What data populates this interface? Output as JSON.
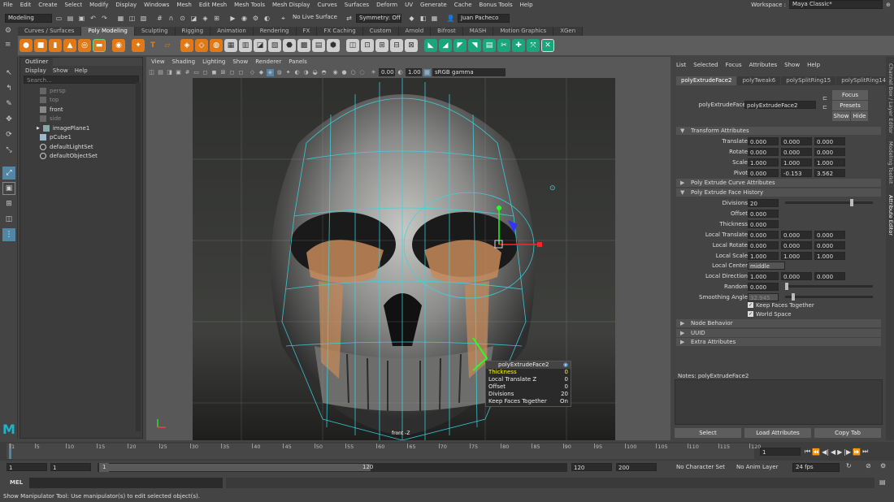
{
  "menubar": {
    "items": [
      "File",
      "Edit",
      "Create",
      "Select",
      "Modify",
      "Display",
      "Windows",
      "Mesh",
      "Edit Mesh",
      "Mesh Tools",
      "Mesh Display",
      "Curves",
      "Surfaces",
      "Deform",
      "UV",
      "Generate",
      "Cache",
      "Bonus Tools",
      "Help"
    ],
    "workspace_label": "Workspace :",
    "workspace_value": "Maya Classic*"
  },
  "statusline": {
    "mode": "Modeling",
    "live_surface": "No Live Surface",
    "symmetry": "Symmetry: Off",
    "user": "Juan Pacheco"
  },
  "shelf": {
    "tabs": [
      "Curves / Surfaces",
      "Poly Modeling",
      "Sculpting",
      "Rigging",
      "Animation",
      "Rendering",
      "FX",
      "FX Caching",
      "Custom",
      "Arnold",
      "Bifrost",
      "MASH",
      "Motion Graphics",
      "XGen"
    ],
    "active_tab": "Poly Modeling"
  },
  "outliner": {
    "title": "Outliner",
    "menu": [
      "Display",
      "Show",
      "Help"
    ],
    "search_placeholder": "Search...",
    "items": [
      {
        "label": "persp",
        "grey": true
      },
      {
        "label": "top",
        "grey": true
      },
      {
        "label": "front",
        "grey": false
      },
      {
        "label": "side",
        "grey": true
      },
      {
        "label": "imagePlane1",
        "grey": false
      },
      {
        "label": "pCube1",
        "grey": false
      },
      {
        "label": "defaultLightSet",
        "grey": false
      },
      {
        "label": "defaultObjectSet",
        "grey": false
      }
    ]
  },
  "viewport": {
    "menu": [
      "View",
      "Shading",
      "Lighting",
      "Show",
      "Renderer",
      "Panels"
    ],
    "exposure": "0.00",
    "gamma": "1.00",
    "colorspace": "sRGB gamma",
    "camera_label": "front -Z"
  },
  "hud": {
    "title": "polyExtrudeFace2",
    "rows": [
      {
        "k": "Thickness",
        "v": "0"
      },
      {
        "k": "Local Translate Z",
        "v": "0"
      },
      {
        "k": "Offset",
        "v": "0"
      },
      {
        "k": "Divisions",
        "v": "20"
      },
      {
        "k": "Keep Faces Together",
        "v": "On"
      }
    ]
  },
  "attr": {
    "menu": [
      "List",
      "Selected",
      "Focus",
      "Attributes",
      "Show",
      "Help"
    ],
    "tabs": [
      "polyExtrudeFace2",
      "polyTweak6",
      "polySplitRing15",
      "polySplitRing14"
    ],
    "node_label": "polyExtrudeFace:",
    "node_value": "polyExtrudeFace2",
    "focus": "Focus",
    "presets": "Presets",
    "show": "Show",
    "hide": "Hide",
    "sections": {
      "transform": "Transform Attributes",
      "curve": "Poly Extrude Curve Attributes",
      "history": "Poly Extrude Face History",
      "node_behavior": "Node Behavior",
      "uuid": "UUID",
      "extra": "Extra Attributes"
    },
    "translate": {
      "label": "Translate",
      "v": [
        "0.000",
        "0.000",
        "0.000"
      ]
    },
    "rotate": {
      "label": "Rotate",
      "v": [
        "0.000",
        "0.000",
        "0.000"
      ]
    },
    "scale": {
      "label": "Scale",
      "v": [
        "1.000",
        "1.000",
        "1.000"
      ]
    },
    "pivot": {
      "label": "Pivot",
      "v": [
        "0.000",
        "-0.153",
        "3.562"
      ]
    },
    "divisions": {
      "label": "Divisions",
      "v": "20"
    },
    "offset": {
      "label": "Offset",
      "v": "0.000"
    },
    "thickness": {
      "label": "Thickness",
      "v": "0.000"
    },
    "ltranslate": {
      "label": "Local Translate",
      "v": [
        "0.000",
        "0.000",
        "0.000"
      ]
    },
    "lrotate": {
      "label": "Local Rotate",
      "v": [
        "0.000",
        "0.000",
        "0.000"
      ]
    },
    "lscale": {
      "label": "Local Scale",
      "v": [
        "1.000",
        "1.000",
        "1.000"
      ]
    },
    "lcenter": {
      "label": "Local Center",
      "v": "middle"
    },
    "ldirection": {
      "label": "Local Direction",
      "v": [
        "1.000",
        "0.000",
        "0.000"
      ]
    },
    "random": {
      "label": "Random",
      "v": "0.000"
    },
    "smoothing": {
      "label": "Smoothing Angle",
      "v": "32.945"
    },
    "keepfaces": "Keep Faces Together",
    "worldspace": "World Space",
    "notes_label": "Notes:",
    "notes_value": "polyExtrudeFace2",
    "btn_select": "Select",
    "btn_load": "Load Attributes",
    "btn_copy": "Copy Tab"
  },
  "sidetabs": [
    "Channel Box / Layer Editor",
    "Modeling Toolkit",
    "Attribute Editor"
  ],
  "timeline": {
    "ticks": [
      "1",
      "5",
      "10",
      "15",
      "20",
      "25",
      "30",
      "35",
      "40",
      "45",
      "50",
      "55",
      "60",
      "65",
      "70",
      "75",
      "80",
      "85",
      "90",
      "95",
      "100",
      "105",
      "110",
      "115",
      "120"
    ],
    "current": "1"
  },
  "range": {
    "start": "1",
    "start2": "1",
    "slider_start": "1",
    "slider_end": "120",
    "end": "120",
    "end2": "200",
    "char_set": "No Character Set",
    "anim_layer": "No Anim Layer",
    "fps": "24 fps"
  },
  "cmd": {
    "label": "MEL"
  },
  "help": "Show Manipulator Tool: Use manipulator(s) to edit selected object(s)."
}
